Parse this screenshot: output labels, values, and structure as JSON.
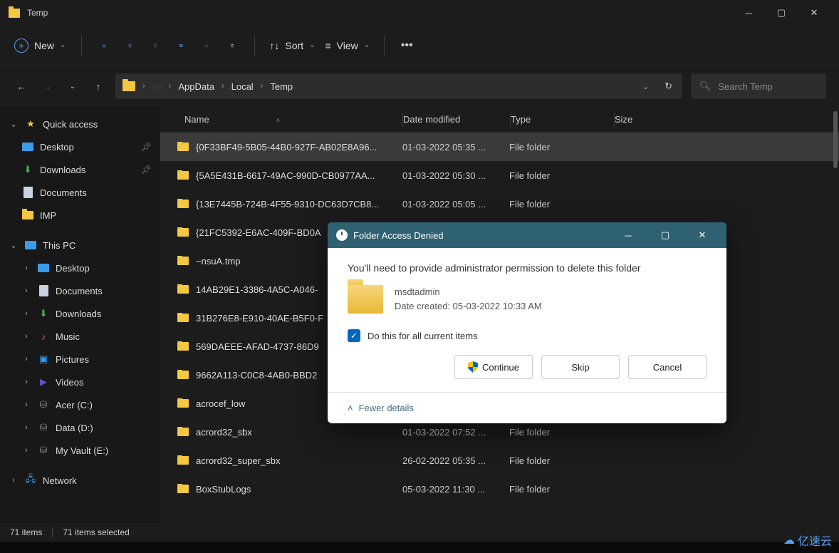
{
  "window": {
    "title": "Temp"
  },
  "toolbar": {
    "new_label": "New",
    "sort_label": "Sort",
    "view_label": "View"
  },
  "breadcrumb": {
    "redacted": "—",
    "seg1": "AppData",
    "seg2": "Local",
    "seg3": "Temp"
  },
  "search": {
    "placeholder": "Search Temp"
  },
  "sidebar": {
    "quick_access": "Quick access",
    "qa": [
      {
        "label": "Desktop"
      },
      {
        "label": "Downloads"
      },
      {
        "label": "Documents"
      },
      {
        "label": "IMP"
      }
    ],
    "this_pc": "This PC",
    "pc": [
      {
        "label": "Desktop"
      },
      {
        "label": "Documents"
      },
      {
        "label": "Downloads"
      },
      {
        "label": "Music"
      },
      {
        "label": "Pictures"
      },
      {
        "label": "Videos"
      },
      {
        "label": "Acer (C:)"
      },
      {
        "label": "Data (D:)"
      },
      {
        "label": "My Vault (E:)"
      }
    ],
    "network": "Network"
  },
  "columns": {
    "name": "Name",
    "date": "Date modified",
    "type": "Type",
    "size": "Size"
  },
  "rows": [
    {
      "name": "{0F33BF49-5B05-44B0-927F-AB02E8A96...",
      "date": "01-03-2022 05:35 ...",
      "type": "File folder",
      "sel": true
    },
    {
      "name": "{5A5E431B-6617-49AC-990D-CB0977AA...",
      "date": "01-03-2022 05:30 ...",
      "type": "File folder",
      "sel": false
    },
    {
      "name": "{13E7445B-724B-4F55-9310-DC63D7CB8...",
      "date": "01-03-2022 05:05 ...",
      "type": "File folder",
      "sel": false
    },
    {
      "name": "{21FC5392-E6AC-409F-BD0A",
      "date": "",
      "type": "",
      "sel": false
    },
    {
      "name": "~nsuA.tmp",
      "date": "",
      "type": "",
      "sel": false
    },
    {
      "name": "14AB29E1-3386-4A5C-A046-",
      "date": "",
      "type": "",
      "sel": false
    },
    {
      "name": "31B276E8-E910-40AE-B5F0-F",
      "date": "",
      "type": "",
      "sel": false
    },
    {
      "name": "569DAEEE-AFAD-4737-86D9",
      "date": "",
      "type": "",
      "sel": false
    },
    {
      "name": "9662A113-C0C8-4AB0-BBD2",
      "date": "",
      "type": "",
      "sel": false
    },
    {
      "name": "acrocef_low",
      "date": "",
      "type": "",
      "sel": false
    },
    {
      "name": "acrord32_sbx",
      "date": "01-03-2022 07:52 ...",
      "type": "File folder",
      "sel": false
    },
    {
      "name": "acrord32_super_sbx",
      "date": "26-02-2022 05:35 ...",
      "type": "File folder",
      "sel": false
    },
    {
      "name": "BoxStubLogs",
      "date": "05-03-2022 11:30 ...",
      "type": "File folder",
      "sel": false
    }
  ],
  "status": {
    "items": "71 items",
    "selected": "71 items selected"
  },
  "dialog": {
    "title": "Folder Access Denied",
    "message": "You'll need to provide administrator permission to delete this folder",
    "folder_name": "msdtadmin",
    "date_created": "Date created: 05-03-2022 10:33 AM",
    "checkbox_label": "Do this for all current items",
    "continue": "Continue",
    "skip": "Skip",
    "cancel": "Cancel",
    "fewer_details": "Fewer details"
  },
  "watermark": "亿速云"
}
